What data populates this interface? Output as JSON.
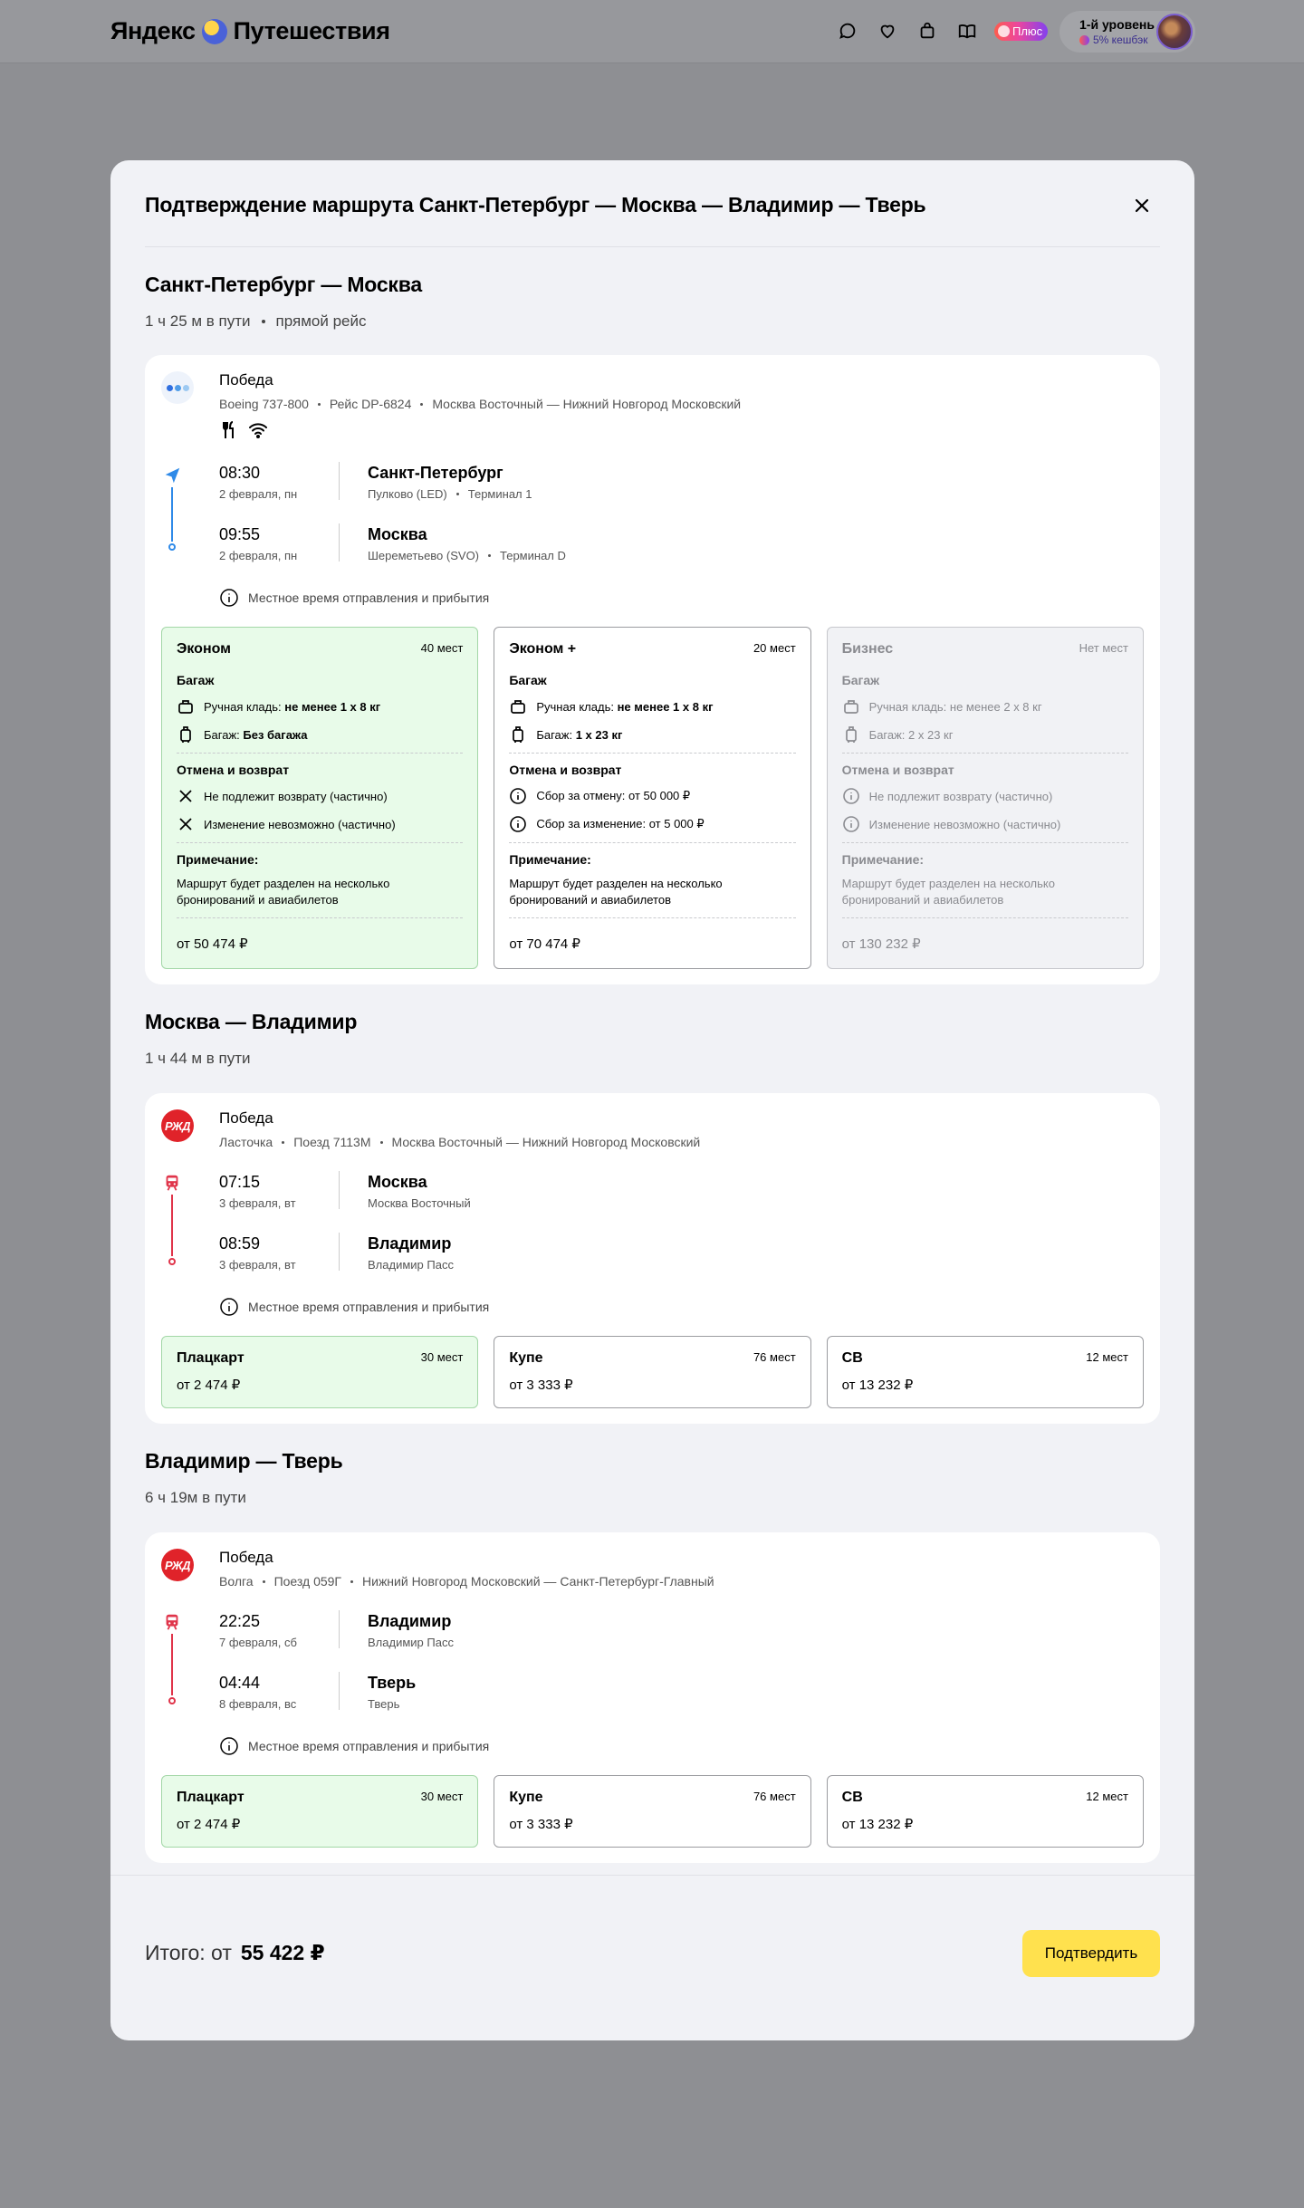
{
  "header": {
    "logo_text": "Яндекс",
    "logo_text2": "Путешествия",
    "plus_label": "Плюс",
    "level_title": "1-й уровень",
    "level_sub": "5% кешбэк"
  },
  "modal": {
    "title": "Подтверждение маршрута Санкт-Петербург — Москва — Владимир — Тверь",
    "note_label": "Местное время отправления и прибытия"
  },
  "segments": [
    {
      "title": "Санкт-Петербург — Москва",
      "duration": "1 ч 25 м в пути",
      "direct": "прямой рейс",
      "carrier": "Победа",
      "meta": [
        "Boeing 737-800",
        "Рейс DP-6824",
        "Москва Восточный — Нижний Новгород Московский"
      ],
      "dep_time": "08:30",
      "dep_date": "2 февраля, пн",
      "dep_city": "Санкт-Петербург",
      "dep_station": "Пулково (LED)",
      "dep_terminal": "Терминал 1",
      "arr_time": "09:55",
      "arr_date": "2 февраля, пн",
      "arr_city": "Москва",
      "arr_station": "Шереметьево (SVO)",
      "arr_terminal": "Терминал D",
      "fares": [
        {
          "name": "Эконом",
          "seats": "40 мест",
          "price": "от 50 474 ₽",
          "baggage_h": "Багаж",
          "hand_label": "Ручная кладь: ",
          "hand_value": "не менее 1 х 8 кг",
          "bag_label": "Багаж: ",
          "bag_value": "Без багажа",
          "refund_h": "Отмена и возврат",
          "refund_1": "Не подлежит возврату (частично)",
          "refund_2": "Изменение невозможно (частично)",
          "note_h": "Примечание:",
          "note": "Маршрут будет разделен на несколько бронирований и авиабилетов"
        },
        {
          "name": "Эконом +",
          "seats": "20 мест",
          "price": "от 70 474 ₽",
          "baggage_h": "Багаж",
          "hand_label": "Ручная кладь: ",
          "hand_value": "не менее 1 х 8 кг",
          "bag_label": "Багаж: ",
          "bag_value": "1 х 23 кг",
          "refund_h": "Отмена и возврат",
          "refund_1": "Сбор за отмену: от 50 000 ₽",
          "refund_2": "Сбор за изменение: от 5 000 ₽",
          "note_h": "Примечание:",
          "note": "Маршрут будет разделен на несколько бронирований и авиабилетов"
        },
        {
          "name": "Бизнес",
          "seats": "Нет мест",
          "price": "от 130 232 ₽",
          "baggage_h": "Багаж",
          "hand_label": "Ручная кладь: ",
          "hand_value": "не менее 2 х 8 кг",
          "bag_label": "Багаж: ",
          "bag_value": "2 х 23 кг",
          "refund_h": "Отмена и возврат",
          "refund_1": "Не подлежит возврату (частично)",
          "refund_2": "Изменение невозможно (частично)",
          "note_h": "Примечание:",
          "note": "Маршрут будет разделен на несколько бронирований и авиабилетов"
        }
      ]
    },
    {
      "title": "Москва — Владимир",
      "duration": "1 ч 44 м в пути",
      "carrier": "Победа",
      "logo": "РЖД",
      "meta": [
        "Ласточка",
        "Поезд 7113М",
        "Москва Восточный — Нижний Новгород Московский"
      ],
      "dep_time": "07:15",
      "dep_date": "3 февраля, вт",
      "dep_city": "Москва",
      "dep_station": "Москва Восточный",
      "arr_time": "08:59",
      "arr_date": "3 февраля, вт",
      "arr_city": "Владимир",
      "arr_station": "Владимир Пасс",
      "fares": [
        {
          "name": "Плацкарт",
          "seats": "30 мест",
          "price": "от 2 474 ₽"
        },
        {
          "name": "Купе",
          "seats": "76 мест",
          "price": "от 3 333 ₽"
        },
        {
          "name": "СВ",
          "seats": "12 мест",
          "price": "от 13 232 ₽"
        }
      ]
    },
    {
      "title": "Владимир — Тверь",
      "duration": "6 ч 19м в пути",
      "carrier": "Победа",
      "logo": "РЖД",
      "meta": [
        "Волга",
        "Поезд 059Г",
        "Нижний Новгород Московский  —  Санкт-Петербург-Главный"
      ],
      "dep_time": "22:25",
      "dep_date": "7 февраля, сб",
      "dep_city": "Владимир",
      "dep_station": "Владимир Пасс",
      "arr_time": "04:44",
      "arr_date": "8 февраля, вс",
      "arr_city": "Тверь",
      "arr_station": "Тверь",
      "fares": [
        {
          "name": "Плацкарт",
          "seats": "30 мест",
          "price": "от 2 474 ₽"
        },
        {
          "name": "Купе",
          "seats": "76 мест",
          "price": "от 3 333 ₽"
        },
        {
          "name": "СВ",
          "seats": "12 мест",
          "price": "от 13 232 ₽"
        }
      ]
    }
  ],
  "footer": {
    "total_label": "Итого: от",
    "total_value": "55 422 ₽",
    "confirm_label": "Подтвердить"
  },
  "colors": {
    "accent_yellow": "#ffe14e",
    "selected_fare_bg": "#e8fbe9",
    "flight_blue": "#2f8ae8",
    "train_red": "#e0344a"
  }
}
